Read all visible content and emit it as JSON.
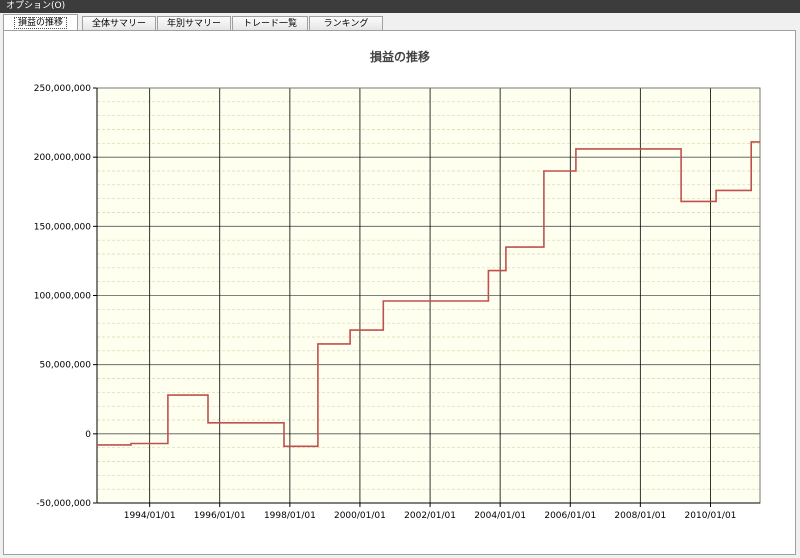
{
  "menu": {
    "options_label": "オプション(O)"
  },
  "tabs": [
    {
      "label": "損益の推移",
      "active": true
    },
    {
      "label": "全体サマリー",
      "active": false
    },
    {
      "label": "年別サマリー",
      "active": false
    },
    {
      "label": "トレード一覧",
      "active": false
    },
    {
      "label": "ランキング",
      "active": false
    }
  ],
  "chart_data": {
    "type": "line",
    "title": "損益の推移",
    "xlabel": "",
    "ylabel": "",
    "ylim": [
      -50000000,
      250000000
    ],
    "y_ticks": [
      -50000000,
      0,
      50000000,
      100000000,
      150000000,
      200000000,
      250000000
    ],
    "y_tick_labels": [
      "-50,000,000",
      "0",
      "50,000,000",
      "100,000,000",
      "150,000,000",
      "200,000,000",
      "250,000,000"
    ],
    "xlim": [
      "1992-07-01",
      "2011-06-01"
    ],
    "x_ticks": [
      "1994-01-01",
      "1996-01-01",
      "1998-01-01",
      "2000-01-01",
      "2002-01-01",
      "2004-01-01",
      "2006-01-01",
      "2008-01-01",
      "2010-01-01"
    ],
    "x_tick_labels": [
      "1994/01/01",
      "1996/01/01",
      "1998/01/01",
      "2000/01/01",
      "2002/01/01",
      "2004/01/01",
      "2006/01/01",
      "2008/01/01",
      "2010/01/01"
    ],
    "grid": true,
    "background_color": "#fffff0",
    "series": [
      {
        "name": "",
        "color": "#c0504d",
        "points": [
          [
            "1992-07-01",
            -8000000
          ],
          [
            "1993-06-20",
            -8000000
          ],
          [
            "1993-06-20",
            -7000000
          ],
          [
            "1994-07-10",
            -7000000
          ],
          [
            "1994-07-10",
            28000000
          ],
          [
            "1995-09-01",
            28000000
          ],
          [
            "1995-09-01",
            8000000
          ],
          [
            "1997-11-01",
            8000000
          ],
          [
            "1997-11-01",
            -9000000
          ],
          [
            "1998-10-20",
            -9000000
          ],
          [
            "1998-10-20",
            65000000
          ],
          [
            "1999-09-20",
            65000000
          ],
          [
            "1999-09-20",
            75000000
          ],
          [
            "2000-09-01",
            75000000
          ],
          [
            "2000-09-01",
            96000000
          ],
          [
            "2003-09-01",
            96000000
          ],
          [
            "2003-09-01",
            118000000
          ],
          [
            "2004-03-01",
            118000000
          ],
          [
            "2004-03-01",
            135000000
          ],
          [
            "2005-04-01",
            135000000
          ],
          [
            "2005-04-01",
            190000000
          ],
          [
            "2006-03-01",
            190000000
          ],
          [
            "2006-03-01",
            206000000
          ],
          [
            "2009-03-01",
            206000000
          ],
          [
            "2009-03-01",
            168000000
          ],
          [
            "2010-03-01",
            168000000
          ],
          [
            "2010-03-01",
            176000000
          ],
          [
            "2011-03-01",
            176000000
          ],
          [
            "2011-03-01",
            211000000
          ],
          [
            "2011-06-01",
            211000000
          ]
        ]
      }
    ]
  }
}
